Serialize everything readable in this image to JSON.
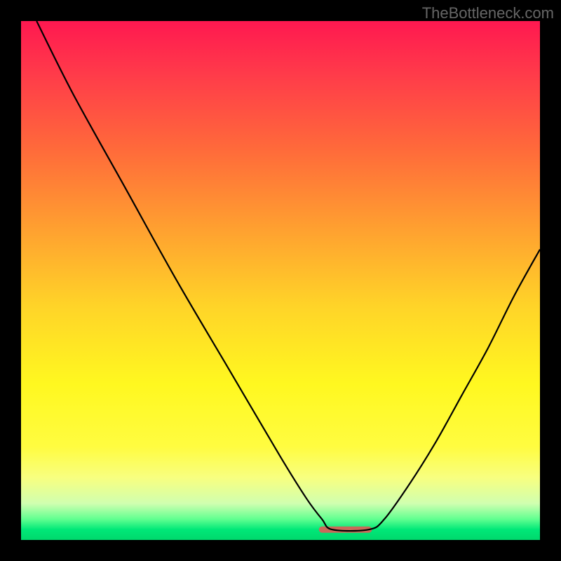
{
  "watermark": "TheBottleneck.com",
  "chart_data": {
    "type": "line",
    "title": "",
    "xlabel": "",
    "ylabel": "",
    "xlim": [
      0,
      100
    ],
    "ylim": [
      0,
      100
    ],
    "grid": false,
    "background_gradient": {
      "top": "#ff1850",
      "mid": "#ffd428",
      "bottom": "#00d86c"
    },
    "series": [
      {
        "name": "bottleneck-curve",
        "color": "#000000",
        "x": [
          3,
          10,
          20,
          30,
          40,
          50,
          55,
          58,
          60,
          67,
          70,
          75,
          80,
          85,
          90,
          95,
          100
        ],
        "y": [
          100,
          86,
          68,
          50,
          33,
          16,
          8,
          4,
          2,
          2,
          4,
          11,
          19,
          28,
          37,
          47,
          56
        ]
      }
    ],
    "flat_region": {
      "name": "optimal-range",
      "color": "#c96a5a",
      "x_start": 58,
      "x_end": 67,
      "y": 2
    }
  }
}
